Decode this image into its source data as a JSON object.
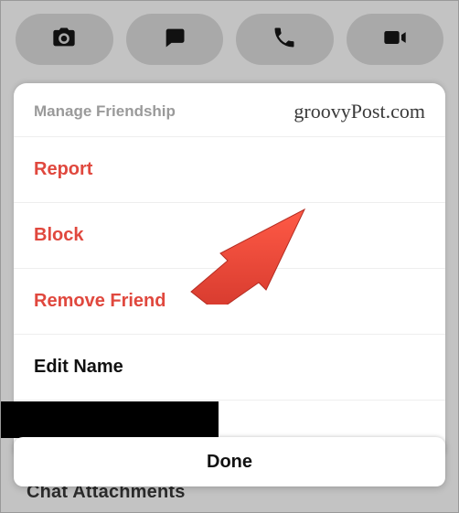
{
  "toolbar": {
    "icons": [
      "camera-icon",
      "chat-icon",
      "phone-icon",
      "video-icon"
    ]
  },
  "background": {
    "partial_text": "Chat Attachments"
  },
  "sheet": {
    "title": "Manage Friendship",
    "watermark": "groovyPost.com",
    "items": [
      {
        "label": "Report",
        "danger": true
      },
      {
        "label": "Block",
        "danger": true
      },
      {
        "label": "Remove Friend",
        "danger": true
      },
      {
        "label": "Edit Name",
        "danger": false
      }
    ]
  },
  "done": {
    "label": "Done"
  }
}
